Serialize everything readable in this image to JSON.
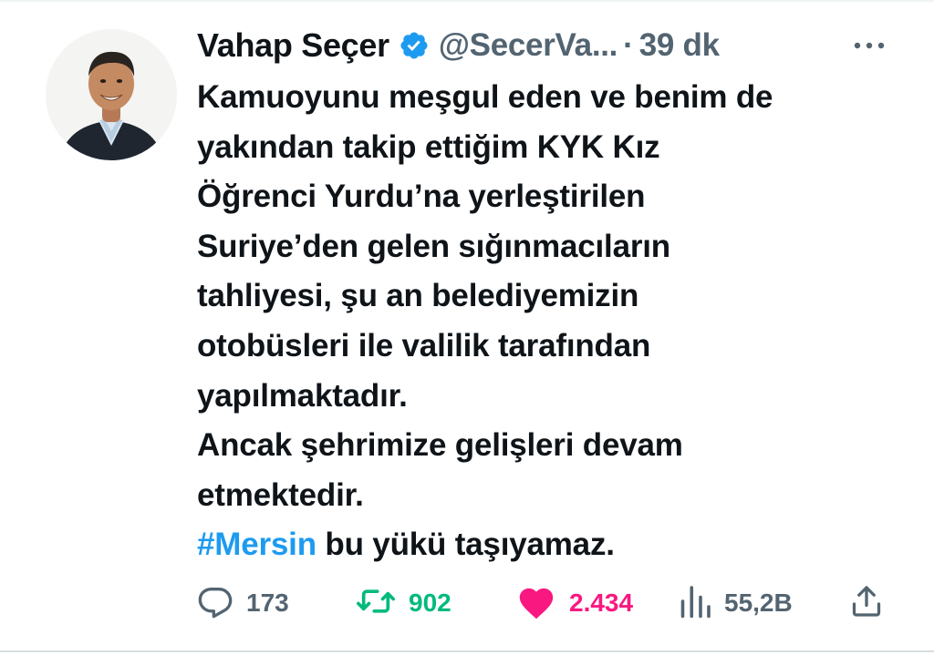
{
  "tweet": {
    "author": {
      "name": "Vahap Seçer",
      "handle": "@SecerVa...",
      "verified": true,
      "avatar_icon": "profile-photo"
    },
    "separator": "·",
    "time": "39 dk",
    "more_icon": "more-horizontal-icon",
    "text_lines": [
      "Kamuoyunu meşgul eden ve benim de",
      "yakından takip ettiğim KYK Kız",
      "Öğrenci Yurdu’na yerleştirilen",
      "Suriye’den gelen sığınmacıların",
      "tahliyesi, şu an belediyemizin",
      "otobüsleri ile valilik tarafından",
      "yapılmaktadır.",
      "Ancak şehrimize gelişleri devam",
      "etmektedir."
    ],
    "last_line": {
      "hashtag": "#Mersin",
      "rest": " bu yükü taşıyamaz."
    },
    "actions": {
      "reply": {
        "icon": "reply-icon",
        "count": "173",
        "color": "#536471"
      },
      "retweet": {
        "icon": "retweet-icon",
        "count": "902",
        "color": "#00ba7c"
      },
      "like": {
        "icon": "heart-icon",
        "count": "2.434",
        "color": "#f91880"
      },
      "views": {
        "icon": "views-icon",
        "count": "55,2B",
        "color": "#536471"
      },
      "share": {
        "icon": "share-icon"
      }
    }
  },
  "colors": {
    "text": "#0f1419",
    "secondary": "#536471",
    "accent": "#1d9bf0",
    "retweet": "#00ba7c",
    "like": "#f91880"
  }
}
